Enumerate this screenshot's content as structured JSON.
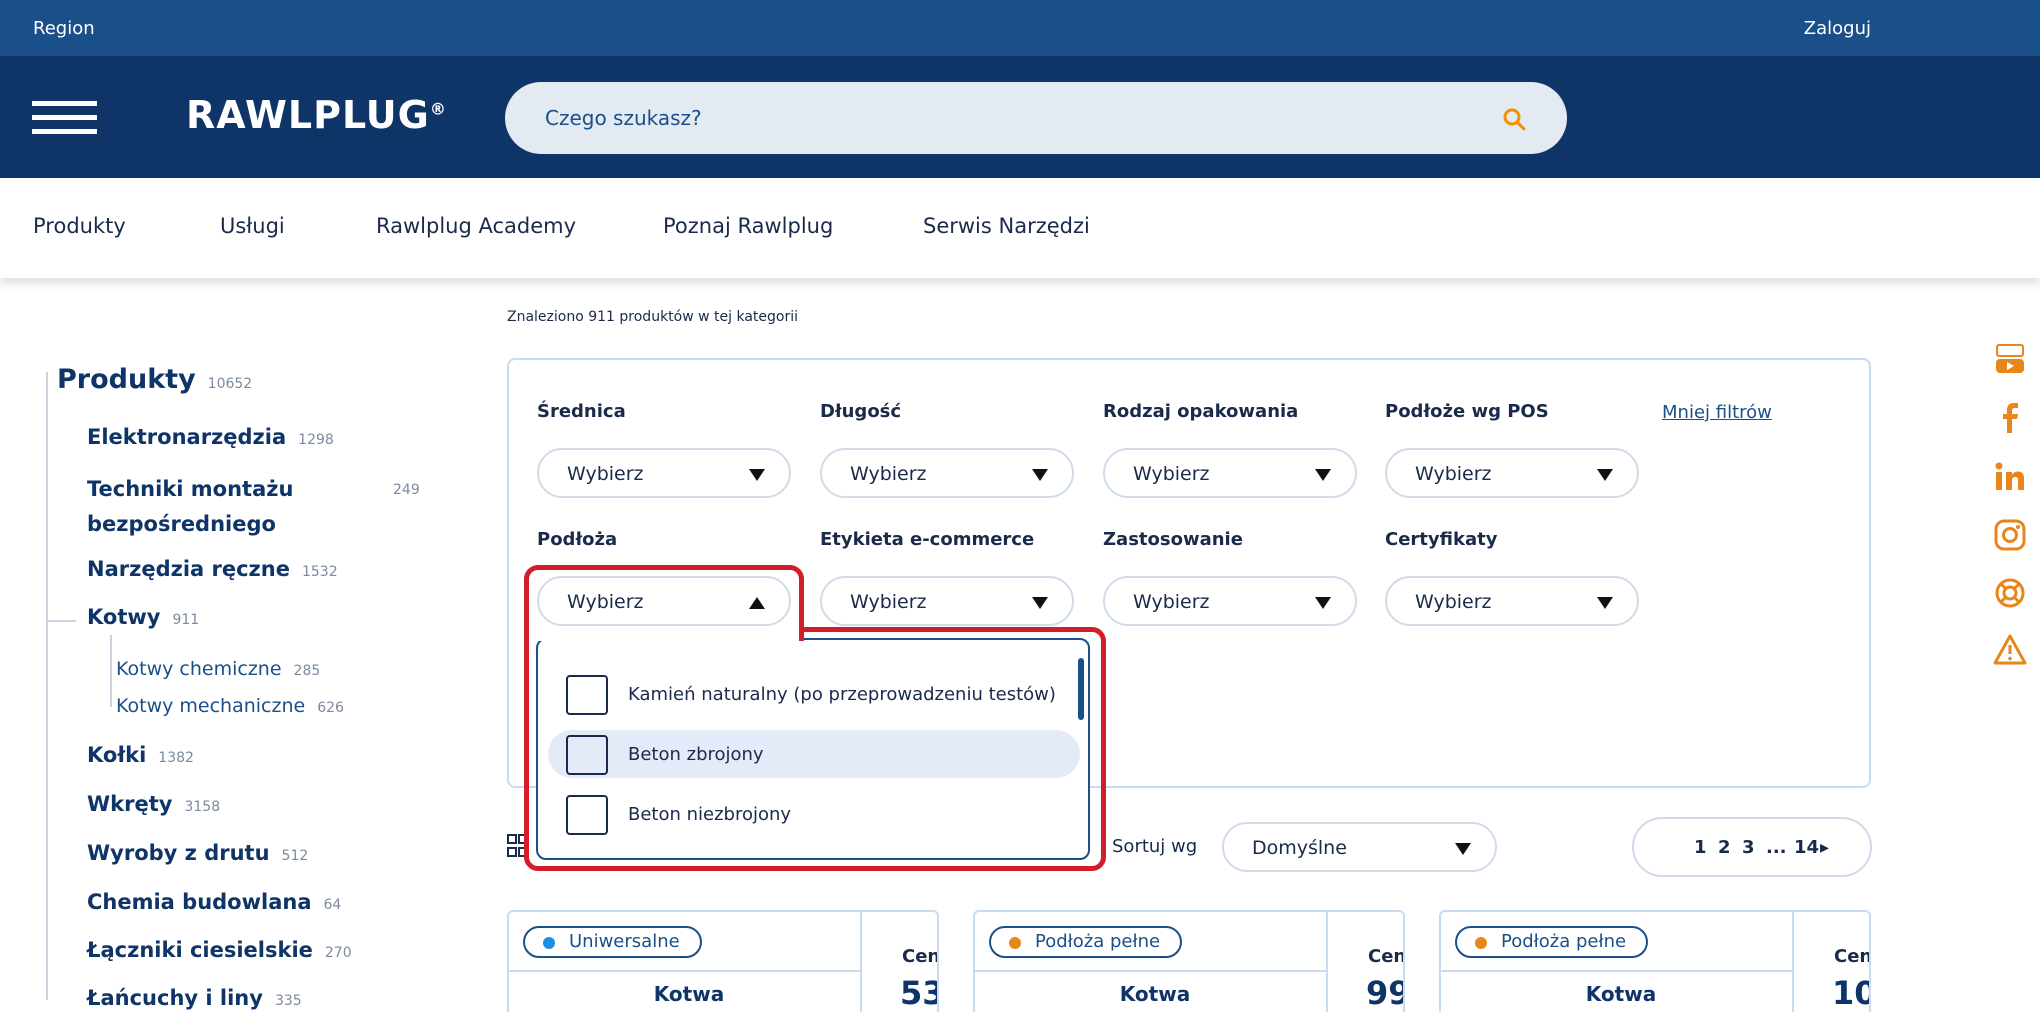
{
  "topbar": {
    "region": "Region",
    "login": "Zaloguj"
  },
  "header": {
    "logo": "RAWLPLUG",
    "logo_mark": "®",
    "search_placeholder": "Czego szukasz?"
  },
  "nav": [
    "Produkty",
    "Usługi",
    "Rawlplug Academy",
    "Poznaj Rawlplug",
    "Serwis Narzędzi"
  ],
  "sidebar": {
    "root": {
      "label": "Produkty",
      "count": "10652"
    },
    "items": [
      {
        "label": "Elektronarzędzia",
        "count": "1298"
      },
      {
        "label": "Techniki montażu",
        "label2": "bezpośredniego",
        "count": "249"
      },
      {
        "label": "Narzędzia ręczne",
        "count": "1532"
      },
      {
        "label": "Kotwy",
        "count": "911"
      },
      {
        "label": "Kołki",
        "count": "1382"
      },
      {
        "label": "Wkręty",
        "count": "3158"
      },
      {
        "label": "Wyroby z drutu",
        "count": "512"
      },
      {
        "label": "Chemia budowlana",
        "count": "64"
      },
      {
        "label": "Łączniki ciesielskie",
        "count": "270"
      },
      {
        "label": "Łańcuchy i liny",
        "count": "335"
      }
    ],
    "subitems": [
      {
        "label": "Kotwy chemiczne",
        "count": "285"
      },
      {
        "label": "Kotwy mechaniczne",
        "count": "626"
      }
    ]
  },
  "main": {
    "found_text": "Znaleziono 911 produktów w tej kategorii",
    "less_filters": "Mniej filtrów",
    "filters": [
      {
        "label": "Średnica",
        "value": "Wybierz"
      },
      {
        "label": "Długość",
        "value": "Wybierz"
      },
      {
        "label": "Rodzaj opakowania",
        "value": "Wybierz"
      },
      {
        "label": "Podłoże wg POS",
        "value": "Wybierz"
      },
      {
        "label": "Podłoża",
        "value": "Wybierz"
      },
      {
        "label": "Etykieta e-commerce",
        "value": "Wybierz"
      },
      {
        "label": "Zastosowanie",
        "value": "Wybierz"
      },
      {
        "label": "Certyfikaty",
        "value": "Wybierz"
      }
    ],
    "dropdown_options": [
      "Kamień naturalny (po przeprowadzeniu testów)",
      "Beton zbrojony",
      "Beton niezbrojony"
    ],
    "sort": {
      "label": "Sortuj wg",
      "value": "Domyślne"
    },
    "pager": {
      "p1": "1",
      "p2": "2",
      "p3": "3",
      "ellipsis": "...",
      "last": "14",
      "next": "▸"
    }
  },
  "cards": [
    {
      "badge": "Uniwersalne",
      "badge_color": "#1a8fe0",
      "name": "Kotwa",
      "price_label": "Cen",
      "price": "53"
    },
    {
      "badge": "Podłoża pełne",
      "badge_color": "#e8861a",
      "name": "Kotwa",
      "price_label": "Cen",
      "price": "99"
    },
    {
      "badge": "Podłoża pełne",
      "badge_color": "#e8861a",
      "name": "Kotwa",
      "price_label": "Cen",
      "price": "10"
    }
  ],
  "social_icons": [
    "youtube-icon",
    "facebook-icon",
    "linkedin-icon",
    "instagram-icon",
    "help-icon",
    "warning-icon"
  ],
  "colors": {
    "header": "#0f3467",
    "topbar": "#1a4f8a",
    "accent": "#f39200",
    "highlight": "#d21d2b"
  }
}
